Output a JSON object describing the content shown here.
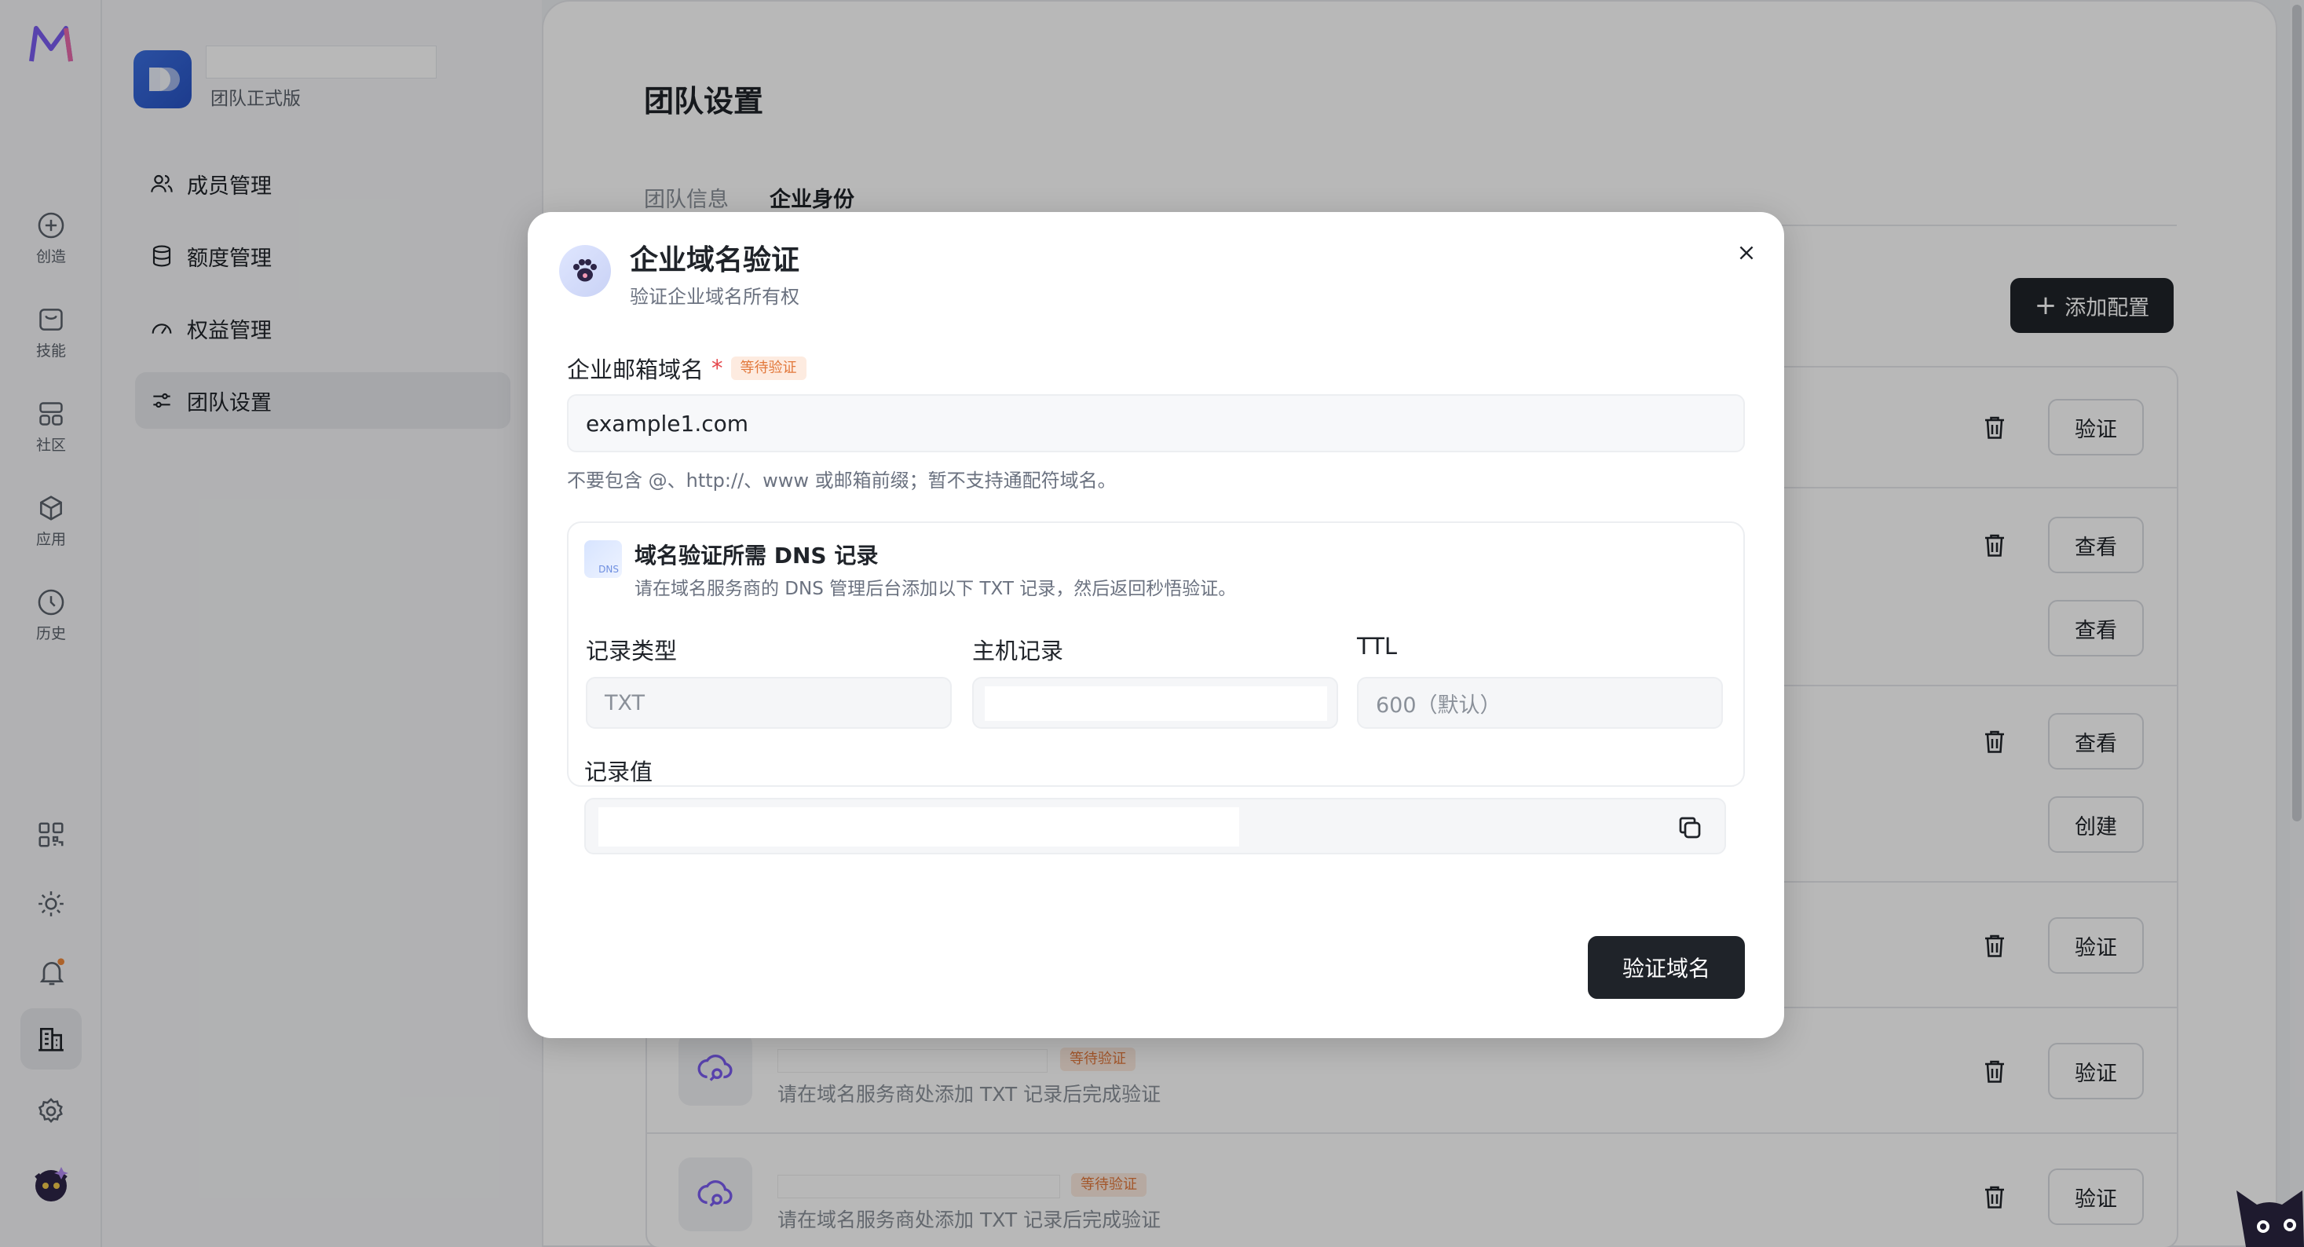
{
  "rail": {
    "items": [
      {
        "label": "创造",
        "icon": "plus-circle-icon"
      },
      {
        "label": "技能",
        "icon": "bag-icon"
      },
      {
        "label": "社区",
        "icon": "grid-icon"
      },
      {
        "label": "应用",
        "icon": "cube-icon"
      },
      {
        "label": "历史",
        "icon": "clock-icon"
      }
    ],
    "bottom_icons": [
      "qr-code-icon",
      "sun-icon",
      "bell-icon",
      "building-icon",
      "gear-icon",
      "avatar"
    ]
  },
  "team": {
    "plan": "团队正式版",
    "nav": [
      {
        "label": "成员管理",
        "icon": "users-icon"
      },
      {
        "label": "额度管理",
        "icon": "database-icon"
      },
      {
        "label": "权益管理",
        "icon": "gauge-icon"
      },
      {
        "label": "团队设置",
        "icon": "sliders-icon"
      }
    ]
  },
  "main": {
    "title": "团队设置",
    "tabs": [
      "团队信息",
      "企业身份"
    ],
    "add_button": "添加配置",
    "rows": [
      {
        "button": "验证"
      },
      {
        "button": "查看"
      },
      {
        "button": "查看"
      },
      {
        "button": "查看"
      },
      {
        "button": "创建"
      },
      {
        "button": "验证"
      },
      {
        "button": "验证",
        "badge": "等待验证",
        "desc": "请在域名服务商处添加 TXT 记录后完成验证"
      },
      {
        "button": "验证",
        "badge": "等待验证",
        "desc": "请在域名服务商处添加 TXT 记录后完成验证"
      }
    ]
  },
  "modal": {
    "title": "企业域名验证",
    "subtitle": "验证企业域名所有权",
    "field_label": "企业邮箱域名",
    "required_mark": "*",
    "status_badge": "等待验证",
    "domain_value": "example1.com",
    "hint": "不要包含 @、http://、www 或邮箱前缀；暂不支持通配符域名。",
    "dns": {
      "icon_text": "DNS",
      "title": "域名验证所需 DNS 记录",
      "desc": "请在域名服务商的 DNS 管理后台添加以下 TXT 记录，然后返回秒悟验证。",
      "col_type": "记录类型",
      "col_host": "主机记录",
      "col_ttl": "TTL",
      "type_value": "TXT",
      "ttl_value": "600（默认）",
      "record_label": "记录值"
    },
    "submit": "验证域名"
  },
  "colors": {
    "accent": "#1f2329",
    "badge_bg": "#fdebe0",
    "badge_fg": "#e2783b",
    "brand_purple": "#7b5cf0"
  }
}
